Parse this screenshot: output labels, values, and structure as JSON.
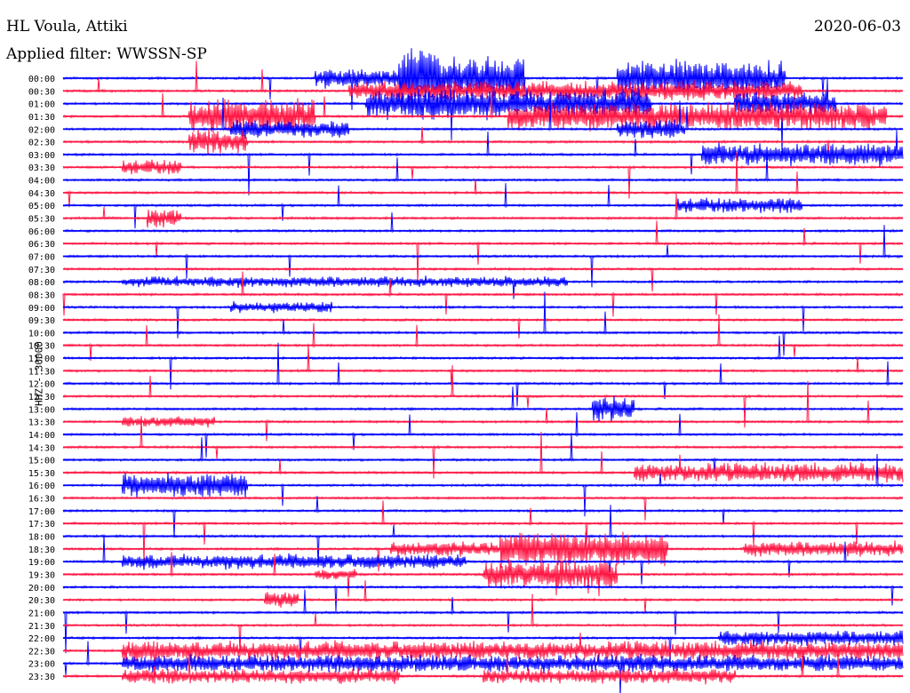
{
  "header": {
    "station": "HL Voula, Attiki",
    "date": "2020-06-03",
    "filter": "Applied filter: WWSSN-SP"
  },
  "colors": {
    "trace_a": "#0000ff",
    "trace_b": "#ff1744",
    "text": "#000000"
  },
  "chart_data": {
    "type": "helicorder",
    "ylabel": "HHZ - 30000",
    "time_labels": [
      "00:00",
      "00:30",
      "01:00",
      "01:30",
      "02:00",
      "02:30",
      "03:00",
      "03:30",
      "04:00",
      "04:30",
      "05:00",
      "05:30",
      "06:00",
      "06:30",
      "07:00",
      "07:30",
      "08:00",
      "08:30",
      "09:00",
      "09:30",
      "10:00",
      "10:30",
      "11:00",
      "11:30",
      "12:00",
      "12:30",
      "13:00",
      "13:30",
      "14:00",
      "14:30",
      "15:00",
      "15:30",
      "16:00",
      "16:30",
      "17:00",
      "17:30",
      "18:00",
      "18:30",
      "19:00",
      "19:30",
      "20:00",
      "20:30",
      "21:00",
      "21:30",
      "22:00",
      "22:30",
      "23:00",
      "23:30"
    ],
    "trace_colors": [
      "blue",
      "red"
    ],
    "activity": [
      {
        "row": 0,
        "start": 0.3,
        "end": 0.45,
        "amp": 1.6
      },
      {
        "row": 0,
        "start": 0.4,
        "end": 0.55,
        "amp": 4.0
      },
      {
        "row": 0,
        "start": 0.66,
        "end": 0.86,
        "amp": 3.0
      },
      {
        "row": 1,
        "start": 0.34,
        "end": 0.88,
        "amp": 1.6
      },
      {
        "row": 2,
        "start": 0.36,
        "end": 0.7,
        "amp": 2.6
      },
      {
        "row": 2,
        "start": 0.8,
        "end": 0.92,
        "amp": 2.0
      },
      {
        "row": 3,
        "start": 0.53,
        "end": 0.98,
        "amp": 2.4
      },
      {
        "row": 3,
        "start": 0.15,
        "end": 0.3,
        "amp": 3.0
      },
      {
        "row": 4,
        "start": 0.2,
        "end": 0.34,
        "amp": 1.4
      },
      {
        "row": 4,
        "start": 0.66,
        "end": 0.74,
        "amp": 1.6
      },
      {
        "row": 5,
        "start": 0.15,
        "end": 0.22,
        "amp": 2.2
      },
      {
        "row": 6,
        "start": 0.76,
        "end": 1.0,
        "amp": 2.0
      },
      {
        "row": 7,
        "start": 0.07,
        "end": 0.14,
        "amp": 1.2
      },
      {
        "row": 10,
        "start": 0.73,
        "end": 0.88,
        "amp": 1.2
      },
      {
        "row": 11,
        "start": 0.1,
        "end": 0.14,
        "amp": 1.6
      },
      {
        "row": 16,
        "start": 0.07,
        "end": 0.6,
        "amp": 0.8
      },
      {
        "row": 18,
        "start": 0.2,
        "end": 0.32,
        "amp": 0.8
      },
      {
        "row": 26,
        "start": 0.63,
        "end": 0.68,
        "amp": 2.2
      },
      {
        "row": 27,
        "start": 0.07,
        "end": 0.18,
        "amp": 0.8
      },
      {
        "row": 31,
        "start": 0.68,
        "end": 1.0,
        "amp": 1.6
      },
      {
        "row": 32,
        "start": 0.07,
        "end": 0.22,
        "amp": 2.2
      },
      {
        "row": 37,
        "start": 0.39,
        "end": 0.72,
        "amp": 1.2
      },
      {
        "row": 37,
        "start": 0.52,
        "end": 0.72,
        "amp": 2.0
      },
      {
        "row": 37,
        "start": 0.81,
        "end": 1.0,
        "amp": 1.2
      },
      {
        "row": 38,
        "start": 0.07,
        "end": 0.48,
        "amp": 1.2
      },
      {
        "row": 39,
        "start": 0.5,
        "end": 0.66,
        "amp": 2.4
      },
      {
        "row": 39,
        "start": 0.3,
        "end": 0.35,
        "amp": 0.8
      },
      {
        "row": 41,
        "start": 0.24,
        "end": 0.28,
        "amp": 1.4
      },
      {
        "row": 44,
        "start": 0.78,
        "end": 1.0,
        "amp": 1.2
      },
      {
        "row": 45,
        "start": 0.07,
        "end": 1.0,
        "amp": 1.6
      },
      {
        "row": 46,
        "start": 0.07,
        "end": 1.0,
        "amp": 1.4
      },
      {
        "row": 47,
        "start": 0.07,
        "end": 0.4,
        "amp": 1.2
      },
      {
        "row": 47,
        "start": 0.5,
        "end": 0.8,
        "amp": 1.2
      }
    ],
    "grid": false
  }
}
